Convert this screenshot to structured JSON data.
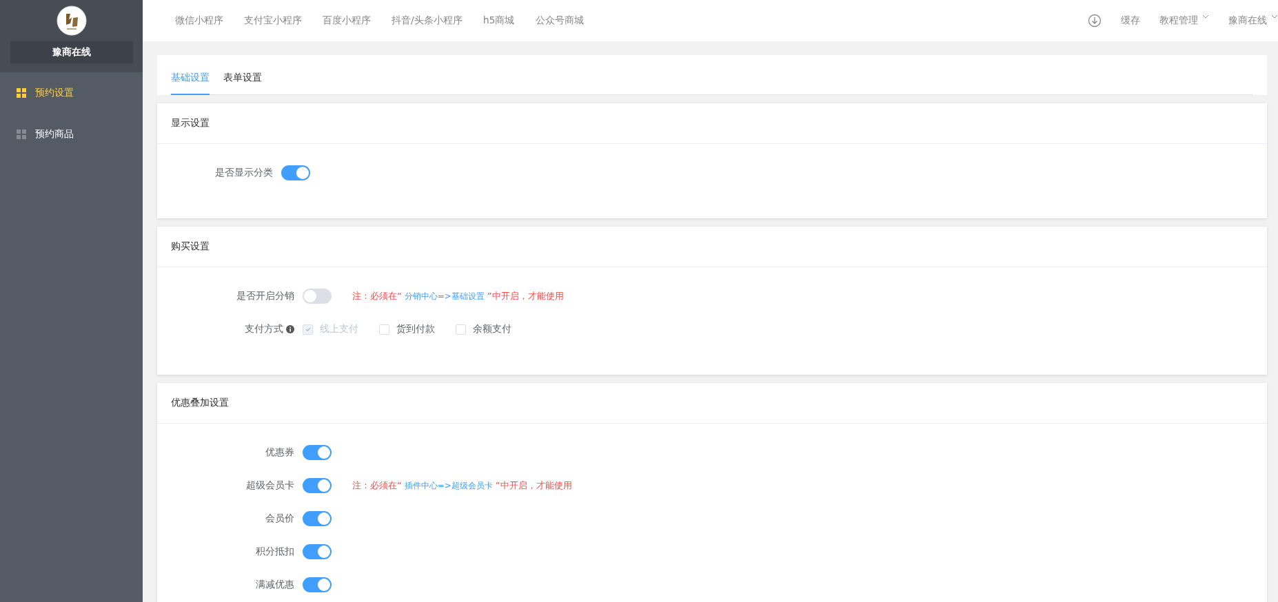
{
  "sidebar": {
    "brand": "豫商在线",
    "items": [
      {
        "label": "预约设置",
        "selected": true
      },
      {
        "label": "预约商品",
        "selected": false
      }
    ]
  },
  "top_nav": {
    "links": [
      "微信小程序",
      "支付宝小程序",
      "百度小程序",
      "抖音/头条小程序",
      "h5商城",
      "公众号商城"
    ],
    "actions": [
      {
        "kind": "icon"
      },
      {
        "kind": "link",
        "label": "缓存"
      },
      {
        "kind": "dropdown",
        "label": "教程管理"
      },
      {
        "kind": "dropdown",
        "label": "豫商在线"
      }
    ]
  },
  "tabs": [
    {
      "label": "基础设置",
      "selected": true
    },
    {
      "label": "表单设置",
      "selected": false
    }
  ],
  "sections": [
    {
      "title": "显示设置",
      "rows": [
        {
          "kind": "switch",
          "label": "是否显示分类",
          "on": true
        }
      ]
    },
    {
      "title": "购买设置",
      "rows": [
        {
          "kind": "switch",
          "label": "是否开启分销",
          "on": false,
          "note": {
            "prefix": "注：必须在“",
            "link": "分销中心=>基础设置",
            "suffix": "”中开启，才能使用"
          }
        },
        {
          "kind": "checkboxes",
          "label": "支付方式",
          "info": true,
          "options": [
            {
              "label": "线上支付",
              "checked": true,
              "disabled": true
            },
            {
              "label": "货到付款",
              "checked": false,
              "disabled": false
            },
            {
              "label": "余额支付",
              "checked": false,
              "disabled": false
            }
          ]
        }
      ]
    },
    {
      "title": "优惠叠加设置",
      "rows": [
        {
          "kind": "switch",
          "label": "优惠券",
          "on": true
        },
        {
          "kind": "switch",
          "label": "超级会员卡",
          "on": true,
          "note": {
            "prefix": "注：必须在“",
            "link": "插件中心=>超级会员卡",
            "suffix": "”中开启，才能使用"
          }
        },
        {
          "kind": "switch",
          "label": "会员价",
          "on": true
        },
        {
          "kind": "switch",
          "label": "积分抵扣",
          "on": true
        },
        {
          "kind": "switch",
          "label": "满减优惠",
          "on": true
        }
      ]
    }
  ]
}
